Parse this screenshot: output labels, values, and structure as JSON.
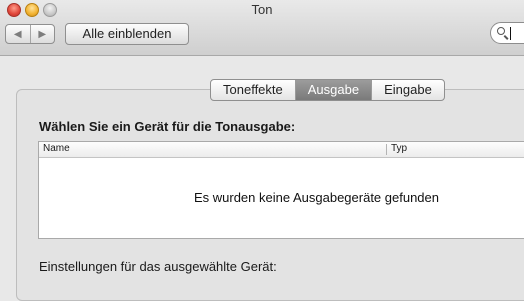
{
  "window": {
    "title": "Ton"
  },
  "toolbar": {
    "show_all_label": "Alle einblenden",
    "search_value": ""
  },
  "tabs": [
    {
      "label": "Toneffekte",
      "active": false
    },
    {
      "label": "Ausgabe",
      "active": true
    },
    {
      "label": "Eingabe",
      "active": false
    }
  ],
  "output": {
    "heading": "Wählen Sie ein Gerät für die Tonausgabe:",
    "columns": {
      "name": "Name",
      "type": "Typ"
    },
    "empty_message": "Es wurden keine Ausgabegeräte gefunden",
    "settings_label": "Einstellungen für das ausgewählte Gerät:"
  },
  "icons": {
    "back": "chevron-left-icon",
    "forward": "chevron-right-icon",
    "search": "search-icon"
  }
}
